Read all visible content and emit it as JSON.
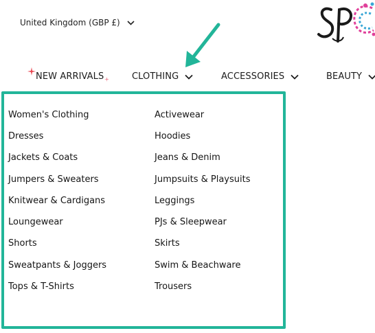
{
  "currency": {
    "label": "United Kingdom (GBP £)",
    "chevron_icon": "chevron-down-icon"
  },
  "logo": {
    "letters": "SP",
    "brand_colors": [
      "#1a1a1a",
      "#e0409a",
      "#3aa7d6"
    ]
  },
  "annotation": {
    "arrow_color": "#22b599"
  },
  "nav": {
    "items": [
      {
        "label": "NEW ARRIVALS",
        "has_dropdown": false,
        "sparkle_color": "#e8454f"
      },
      {
        "label": "CLOTHING",
        "has_dropdown": true
      },
      {
        "label": "ACCESSORIES",
        "has_dropdown": true
      },
      {
        "label": "BEAUTY",
        "has_dropdown": true
      }
    ]
  },
  "menu": {
    "border_color": "#22b599",
    "column_1": [
      "Women's Clothing",
      "Dresses",
      "Jackets & Coats",
      "Jumpers & Sweaters",
      "Knitwear & Cardigans",
      "Loungewear",
      "Shorts",
      "Sweatpants & Joggers",
      "Tops & T-Shirts"
    ],
    "column_2": [
      "Activewear",
      "Hoodies",
      "Jeans & Denim",
      "Jumpsuits & Playsuits",
      "Leggings",
      "PJs & Sleepwear",
      "Skirts",
      "Swim & Beachware",
      "Trousers"
    ]
  }
}
